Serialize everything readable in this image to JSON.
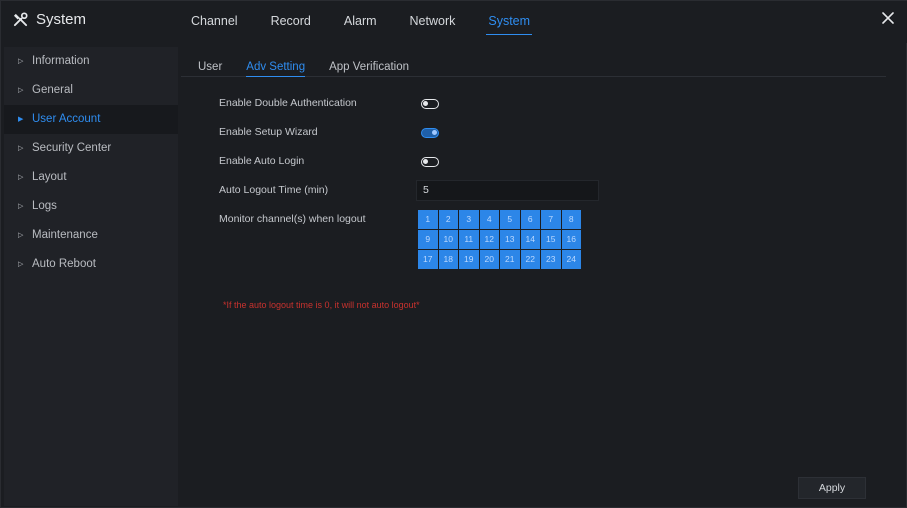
{
  "app": {
    "title": "System",
    "icon": "tools-icon"
  },
  "nav": {
    "items": [
      {
        "label": "Channel",
        "active": false
      },
      {
        "label": "Record",
        "active": false
      },
      {
        "label": "Alarm",
        "active": false
      },
      {
        "label": "Network",
        "active": false
      },
      {
        "label": "System",
        "active": true
      }
    ]
  },
  "sidebar": {
    "items": [
      {
        "label": "Information",
        "active": false
      },
      {
        "label": "General",
        "active": false
      },
      {
        "label": "User Account",
        "active": true
      },
      {
        "label": "Security Center",
        "active": false
      },
      {
        "label": "Layout",
        "active": false
      },
      {
        "label": "Logs",
        "active": false
      },
      {
        "label": "Maintenance",
        "active": false
      },
      {
        "label": "Auto Reboot",
        "active": false
      }
    ]
  },
  "subtabs": [
    {
      "label": "User",
      "active": false
    },
    {
      "label": "Adv Setting",
      "active": true
    },
    {
      "label": "App Verification",
      "active": false
    }
  ],
  "settings": {
    "double_auth": {
      "label": "Enable Double Authentication",
      "on": false
    },
    "setup_wizard": {
      "label": "Enable Setup Wizard",
      "on": true
    },
    "auto_login": {
      "label": "Enable Auto Login",
      "on": false
    },
    "logout_time": {
      "label": "Auto Logout Time (min)",
      "value": "5"
    },
    "monitor_channels": {
      "label": "Monitor channel(s) when logout",
      "channels": [
        "1",
        "2",
        "3",
        "4",
        "5",
        "6",
        "7",
        "8",
        "9",
        "10",
        "11",
        "12",
        "13",
        "14",
        "15",
        "16",
        "17",
        "18",
        "19",
        "20",
        "21",
        "22",
        "23",
        "24"
      ]
    }
  },
  "note": "*If the auto logout time is 0, it will not auto logout*",
  "apply_label": "Apply",
  "colors": {
    "accent": "#2f8df0",
    "warning": "#c8322e",
    "channel_bg": "#2c86e8"
  }
}
